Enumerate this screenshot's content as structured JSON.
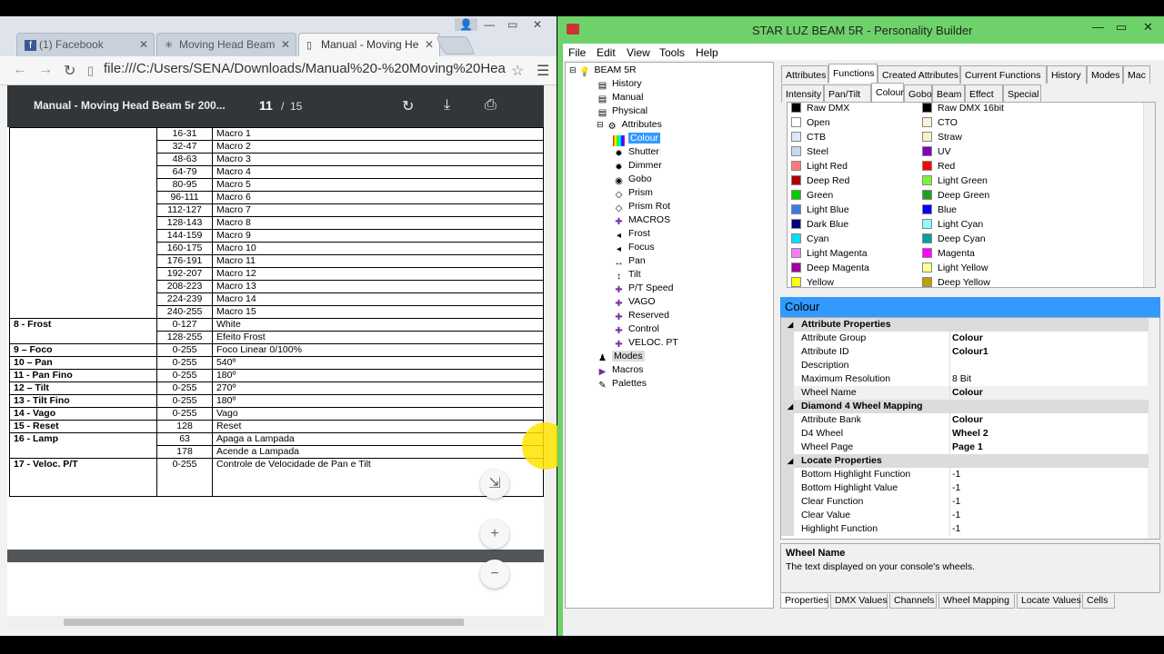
{
  "browser": {
    "tabs": [
      {
        "title": "(1) Facebook",
        "icon": "f"
      },
      {
        "title": "Moving Head Beam",
        "icon": "✳"
      },
      {
        "title": "Manual - Moving He",
        "icon": "📄"
      }
    ],
    "url": "file:///C:/Users/SENA/Downloads/Manual%20-%20Moving%20Hea"
  },
  "pdf": {
    "title": "Manual - Moving Head Beam 5r 200...",
    "page": "11",
    "separator": "/",
    "total": "15",
    "rows": [
      {
        "ch": "",
        "range": "16-31",
        "desc": "Macro 1"
      },
      {
        "ch": "",
        "range": "32-47",
        "desc": "Macro 2"
      },
      {
        "ch": "",
        "range": "48-63",
        "desc": "Macro 3"
      },
      {
        "ch": "",
        "range": "64-79",
        "desc": "Macro 4"
      },
      {
        "ch": "",
        "range": "80-95",
        "desc": "Macro 5"
      },
      {
        "ch": "",
        "range": "96-111",
        "desc": "Macro 6"
      },
      {
        "ch": "",
        "range": "112-127",
        "desc": "Macro 7"
      },
      {
        "ch": "",
        "range": "128-143",
        "desc": "Macro 8"
      },
      {
        "ch": "",
        "range": "144-159",
        "desc": "Macro 9"
      },
      {
        "ch": "",
        "range": "160-175",
        "desc": "Macro 10"
      },
      {
        "ch": "",
        "range": "176-191",
        "desc": "Macro 11"
      },
      {
        "ch": "",
        "range": "192-207",
        "desc": "Macro 12"
      },
      {
        "ch": "",
        "range": "208-223",
        "desc": "Macro 13"
      },
      {
        "ch": "",
        "range": "224-239",
        "desc": "Macro 14"
      },
      {
        "ch": "",
        "range": "240-255",
        "desc": "Macro 15"
      },
      {
        "ch": "8 - Frost",
        "range": "0-127",
        "desc": "White"
      },
      {
        "ch": "",
        "range": "128-255",
        "desc": "Efeito Frost"
      },
      {
        "ch": "9 – Foco",
        "range": "0-255",
        "desc": "Foco Linear 0/100%"
      },
      {
        "ch": "10 – Pan",
        "range": "0-255",
        "desc": "540º"
      },
      {
        "ch": "11 - Pan Fino",
        "range": "0-255",
        "desc": "180º"
      },
      {
        "ch": "12 – Tilt",
        "range": "0-255",
        "desc": "270º"
      },
      {
        "ch": "13 - Tilt Fino",
        "range": "0-255",
        "desc": "180º"
      },
      {
        "ch": "14 - Vago",
        "range": "0-255",
        "desc": "Vago"
      },
      {
        "ch": "15 - Reset",
        "range": "128",
        "desc": "Reset"
      },
      {
        "ch": "16 - Lamp",
        "range": "63",
        "desc": "Apaga a Lampada"
      },
      {
        "ch": "",
        "range": "178",
        "desc": "Acende a Lampada"
      },
      {
        "ch": "17 - Veloc. P/T",
        "range": "0-255",
        "desc": "Controle de Velocidade de Pan e Tilt"
      }
    ]
  },
  "pb": {
    "title": "STAR LUZ BEAM 5R - Personality Builder",
    "menu": [
      "File",
      "Edit",
      "View",
      "Tools",
      "Help"
    ],
    "tree": [
      {
        "label": "BEAM 5R",
        "icon": "💡"
      },
      {
        "label": "History",
        "icon": "▤"
      },
      {
        "label": "Manual",
        "icon": "▤"
      },
      {
        "label": "Physical",
        "icon": "▤"
      },
      {
        "label": "Attributes",
        "icon": "⚙"
      },
      {
        "label": "Colour",
        "icon": "▦"
      },
      {
        "label": "Shutter",
        "icon": "✹"
      },
      {
        "label": "Dimmer",
        "icon": "✹"
      },
      {
        "label": "Gobo",
        "icon": "◉"
      },
      {
        "label": "Prism",
        "icon": "◇"
      },
      {
        "label": "Prism Rot",
        "icon": "◇"
      },
      {
        "label": "MACROS",
        "icon": "✚"
      },
      {
        "label": "Frost",
        "icon": "◂"
      },
      {
        "label": "Focus",
        "icon": "◂"
      },
      {
        "label": "Pan",
        "icon": "↔"
      },
      {
        "label": "Tilt",
        "icon": "↕"
      },
      {
        "label": "P/T Speed",
        "icon": "✚"
      },
      {
        "label": "VAGO",
        "icon": "✚"
      },
      {
        "label": "Reserved",
        "icon": "✚"
      },
      {
        "label": "Control",
        "icon": "✚"
      },
      {
        "label": "VELOC. PT",
        "icon": "✚"
      },
      {
        "label": "Modes",
        "icon": "♟"
      },
      {
        "label": "Macros",
        "icon": "▶"
      },
      {
        "label": "Palettes",
        "icon": "✎"
      }
    ],
    "tabs1": [
      "Attributes",
      "Functions",
      "Created Attributes",
      "Current Functions",
      "History",
      "Modes",
      "Mac"
    ],
    "tabs2": [
      "Intensity",
      "Pan/Tilt",
      "Colour",
      "Gobo",
      "Beam",
      "Effect",
      "Special"
    ],
    "colors_left": [
      {
        "name": "Raw DMX",
        "color": "#000000"
      },
      {
        "name": "Open",
        "color": "#ffffff"
      },
      {
        "name": "CTB",
        "color": "#dde8f8"
      },
      {
        "name": "Steel",
        "color": "#c8d8ec"
      },
      {
        "name": "Light Red",
        "color": "#ff7a7a"
      },
      {
        "name": "Deep Red",
        "color": "#b00000"
      },
      {
        "name": "Green",
        "color": "#00cc00"
      },
      {
        "name": "Light Blue",
        "color": "#3a7fe0"
      },
      {
        "name": "Dark Blue",
        "color": "#000080"
      },
      {
        "name": "Cyan",
        "color": "#00e0f0"
      },
      {
        "name": "Light Magenta",
        "color": "#f080f0"
      },
      {
        "name": "Deep Magenta",
        "color": "#a000a0"
      },
      {
        "name": "Yellow",
        "color": "#ffff00"
      }
    ],
    "colors_right": [
      {
        "name": "Raw DMX 16bit",
        "color": "#000000"
      },
      {
        "name": "CTO",
        "color": "#fff0d8"
      },
      {
        "name": "Straw",
        "color": "#f8f0c8"
      },
      {
        "name": "UV",
        "color": "#8000c0"
      },
      {
        "name": "Red",
        "color": "#ff0000"
      },
      {
        "name": "Light Green",
        "color": "#80f040"
      },
      {
        "name": "Deep Green",
        "color": "#20a020"
      },
      {
        "name": "Blue",
        "color": "#0000ff"
      },
      {
        "name": "Light Cyan",
        "color": "#90f8ff"
      },
      {
        "name": "Deep Cyan",
        "color": "#00a0a0"
      },
      {
        "name": "Magenta",
        "color": "#ff00ff"
      },
      {
        "name": "Light Yellow",
        "color": "#ffff90"
      },
      {
        "name": "Deep Yellow",
        "color": "#c0a000"
      }
    ],
    "prop_header": "Colour",
    "props": [
      {
        "k": "Attribute Properties",
        "v": "",
        "cat": true
      },
      {
        "k": "Attribute Group",
        "v": "Colour",
        "b": true
      },
      {
        "k": "Attribute ID",
        "v": "Colour1",
        "b": true
      },
      {
        "k": "Description",
        "v": ""
      },
      {
        "k": "Maximum Resolution",
        "v": "8 Bit"
      },
      {
        "k": "Wheel Name",
        "v": "Colour",
        "b": true,
        "sel": true
      },
      {
        "k": "Diamond 4 Wheel Mapping",
        "v": "",
        "cat": true
      },
      {
        "k": "Attribute Bank",
        "v": "Colour",
        "b": true
      },
      {
        "k": "D4 Wheel",
        "v": "Wheel 2",
        "b": true
      },
      {
        "k": "Wheel Page",
        "v": "Page 1",
        "b": true
      },
      {
        "k": "Locate Properties",
        "v": "",
        "cat": true
      },
      {
        "k": "Bottom Highlight Function",
        "v": "-1"
      },
      {
        "k": "Bottom Highlight Value",
        "v": "-1"
      },
      {
        "k": "Clear Function",
        "v": "-1"
      },
      {
        "k": "Clear Value",
        "v": "-1"
      },
      {
        "k": "Highlight Function",
        "v": "-1"
      }
    ],
    "desc_title": "Wheel Name",
    "desc_text": "The text displayed on your console's wheels.",
    "bottom_tabs": [
      "Properties",
      "DMX Values",
      "Channels",
      "Wheel Mapping",
      "Locate Values",
      "Cells"
    ]
  }
}
